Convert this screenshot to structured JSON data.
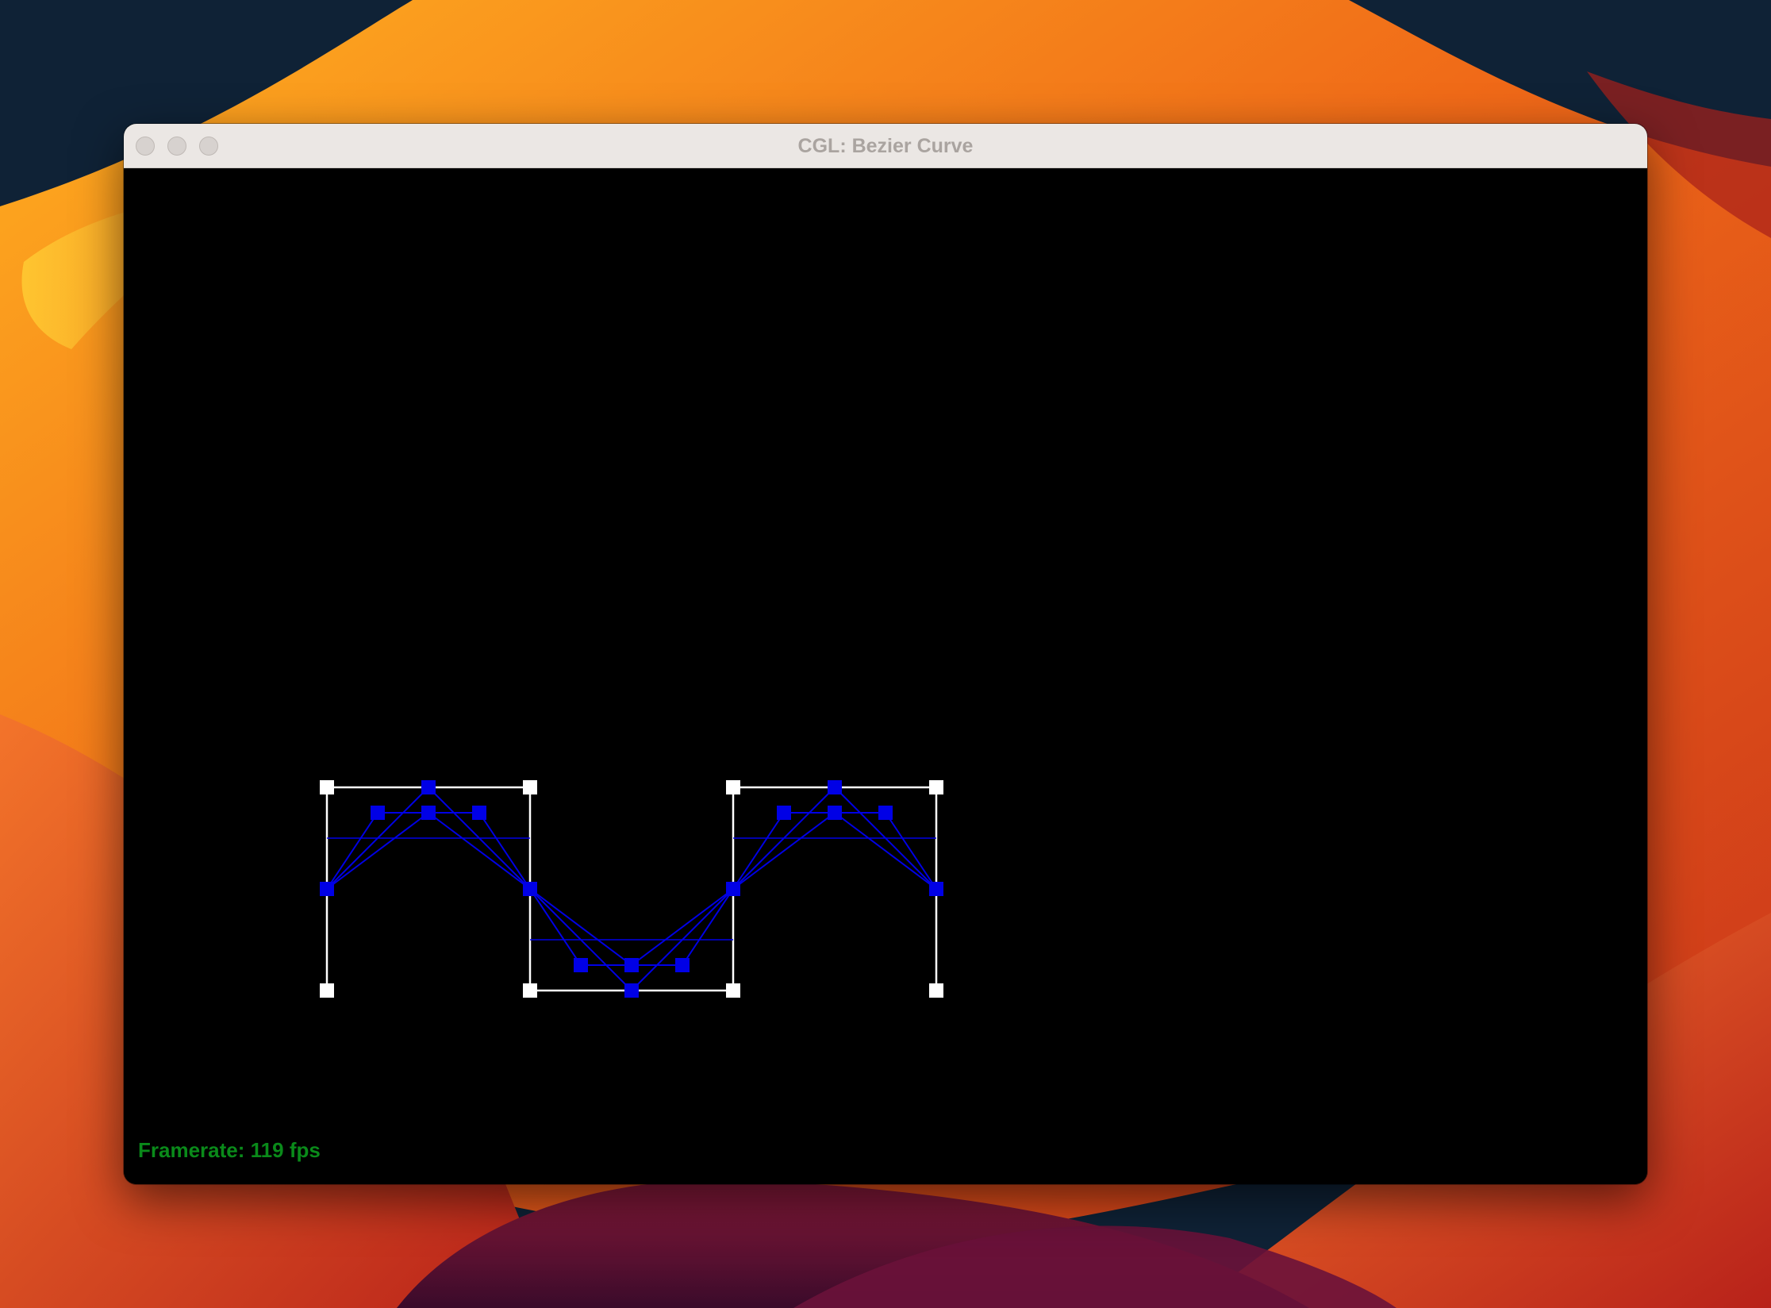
{
  "window": {
    "title": "CGL: Bezier Curve",
    "traffic_lights": [
      "close",
      "minimize",
      "maximize"
    ]
  },
  "viewport": {
    "background": "#000000",
    "framerate_label": "Framerate:",
    "framerate_value": "119",
    "framerate_unit": "fps",
    "framerate_color": "#0a8a1a"
  },
  "bezier": {
    "segments": 3,
    "control_point_color": "#ffffff",
    "control_polygon_color": "#ffffff",
    "subdivision_color": "#0000e6"
  }
}
